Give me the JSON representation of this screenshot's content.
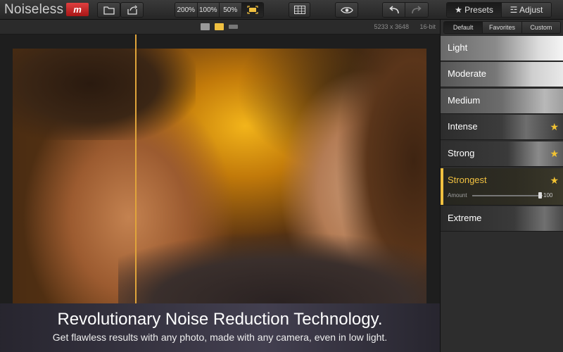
{
  "app": {
    "title": "Noiseless",
    "logo_text": "m"
  },
  "toolbar": {
    "zoom_options": [
      "200%",
      "100%",
      "50%"
    ],
    "presets_tab": "★ Presets",
    "adjust_tab": "☲ Adjust"
  },
  "subbar": {
    "resolution": "5233 x 3648",
    "bit_depth": "16-bit"
  },
  "caption": {
    "title": "Revolutionary Noise Reduction Technology.",
    "subtitle": "Get flawless results with any photo, made with any camera, even in low light."
  },
  "panel": {
    "subtabs": [
      "Default",
      "Favorites",
      "Custom"
    ],
    "presets": [
      {
        "label": "Light",
        "favorite": false
      },
      {
        "label": "Moderate",
        "favorite": false
      },
      {
        "label": "Medium",
        "favorite": false
      },
      {
        "label": "Intense",
        "favorite": true
      },
      {
        "label": "Strong",
        "favorite": true
      },
      {
        "label": "Strongest",
        "favorite": true,
        "selected": true,
        "amount_label": "Amount",
        "amount_value": "100"
      },
      {
        "label": "Extreme",
        "favorite": false
      }
    ]
  },
  "colors": {
    "accent": "#f0c040",
    "logo": "#c81e1e"
  }
}
